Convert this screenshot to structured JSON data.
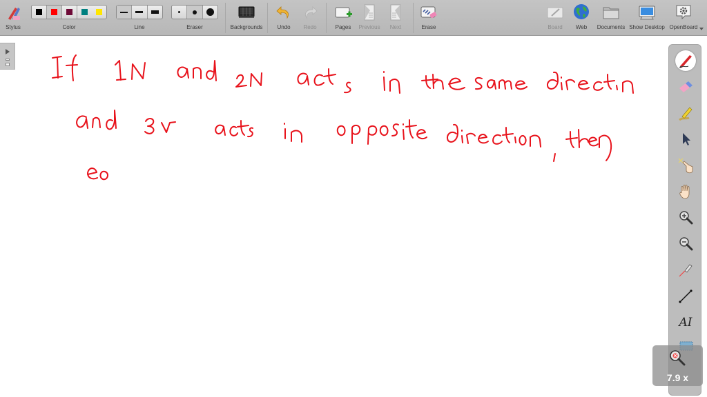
{
  "toolbar": {
    "stylus": {
      "label": "Stylus",
      "icon": "stylus-icon"
    },
    "color": {
      "label": "Color",
      "swatches": [
        "#000000",
        "#ff0000",
        "#6e0a37",
        "#008080",
        "#ffe600"
      ],
      "selected_index": 1
    },
    "line": {
      "label": "Line",
      "options": [
        "thin",
        "medium",
        "thick"
      ],
      "selected_index": 0
    },
    "eraser": {
      "label": "Eraser",
      "options": [
        "small",
        "medium",
        "large"
      ]
    },
    "backgrounds": {
      "label": "Backgrounds",
      "icon": "backgrounds-icon"
    },
    "undo": {
      "label": "Undo",
      "icon": "undo-icon",
      "enabled": true
    },
    "redo": {
      "label": "Redo",
      "icon": "redo-icon",
      "enabled": false
    },
    "pages": {
      "label": "Pages",
      "icon": "add-page-icon"
    },
    "previous": {
      "label": "Previous",
      "icon": "previous-page-icon",
      "enabled": false
    },
    "next": {
      "label": "Next",
      "icon": "next-page-icon",
      "enabled": false
    },
    "erase": {
      "label": "Erase",
      "icon": "erase-board-icon"
    },
    "board": {
      "label": "Board",
      "icon": "board-icon",
      "enabled": false
    },
    "web": {
      "label": "Web",
      "icon": "globe-icon"
    },
    "documents": {
      "label": "Documents",
      "icon": "folder-icon"
    },
    "show_desktop": {
      "label": "Show Desktop",
      "icon": "monitor-icon"
    },
    "openboard": {
      "label": "OpenBoard",
      "icon": "gear-icon"
    }
  },
  "palette": {
    "tools": [
      "pen",
      "eraser",
      "marker",
      "selector",
      "interactor",
      "hand",
      "zoom-in",
      "zoom-out",
      "laser-pointer",
      "line",
      "text",
      "capture"
    ],
    "active_tool": "pen"
  },
  "zoom_indicator": {
    "label": "7.9 x"
  },
  "board": {
    "ink_color": "#e8121b",
    "handwriting_lines": [
      "If 1N and 2N acts in the same direction",
      "and 3N acts in opposite direction, then",
      "eo"
    ]
  }
}
